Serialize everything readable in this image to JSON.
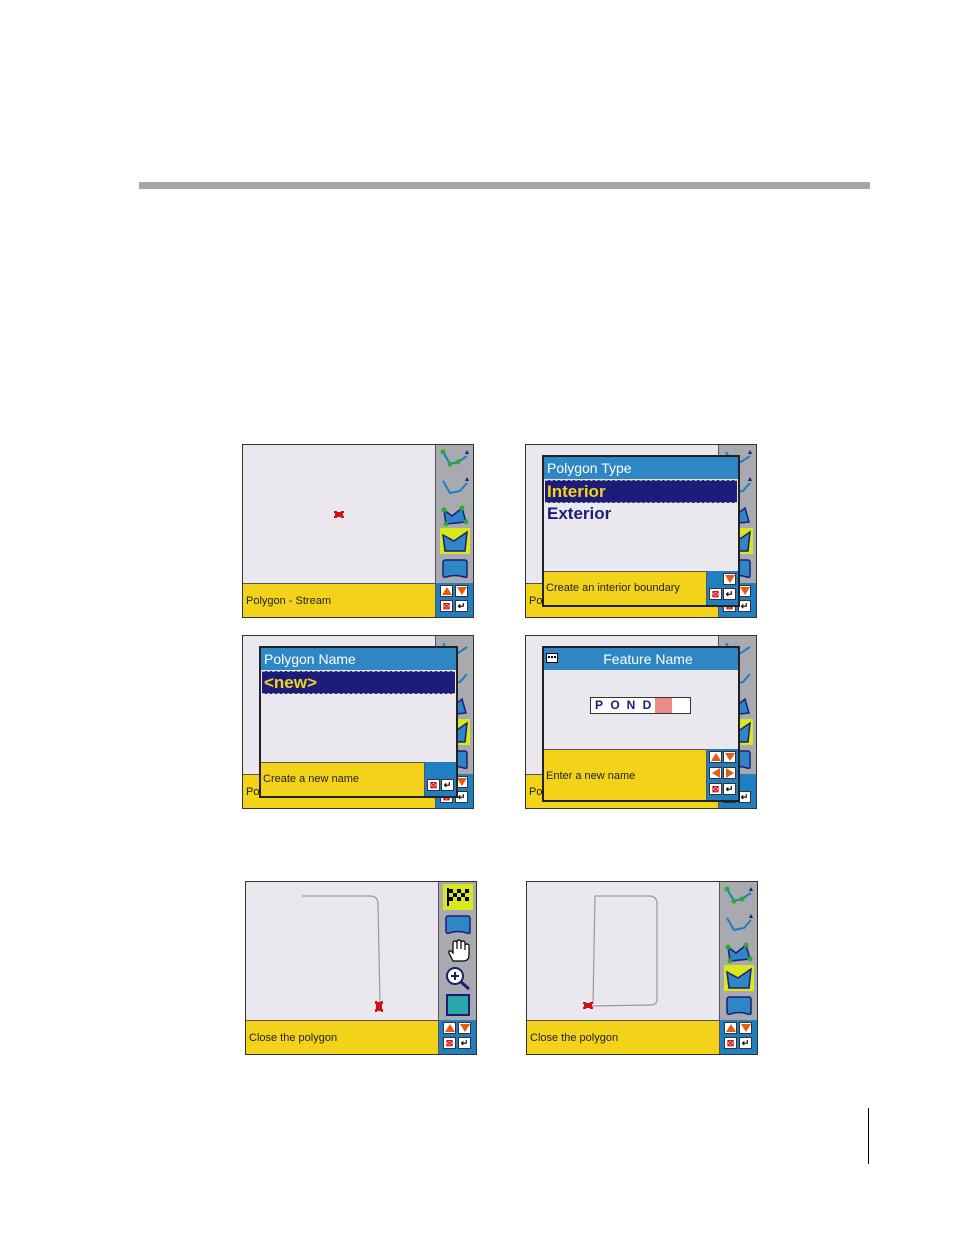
{
  "screens": [
    {
      "id": "s1",
      "status": "Polygon - Stream",
      "toolbar": [
        "line-vertices-icon",
        "stream-line-icon",
        "polygon-vertices-icon",
        "stream-polygon-icon",
        "area-shape-icon"
      ],
      "active_tool": "stream-polygon-icon"
    },
    {
      "id": "s2",
      "status": "Pol",
      "dialog": {
        "title": "Polygon Type",
        "items": [
          "Interior",
          "Exterior"
        ],
        "selected": "Interior",
        "status": "Create an interior boundary"
      }
    },
    {
      "id": "s3",
      "status": "Pol",
      "dialog": {
        "title": "Polygon Name",
        "items": [
          "<new>"
        ],
        "selected": "<new>",
        "status": "Create a new name"
      }
    },
    {
      "id": "s4",
      "status": "Pol",
      "dialog": {
        "title": "Feature Name",
        "input_letters": [
          "P",
          "O",
          "N",
          "D"
        ],
        "status": "Enter a new name"
      }
    },
    {
      "id": "s5",
      "status": "Close the polygon",
      "toolbar": [
        "checkered-flag-icon",
        "area-shape-icon",
        "pan-hand-icon",
        "zoom-in-icon",
        "teal-square-icon"
      ],
      "active_tool": "checkered-flag-icon"
    },
    {
      "id": "s6",
      "status": "Close the polygon",
      "toolbar": [
        "line-vertices-icon",
        "stream-line-icon",
        "polygon-vertices-icon",
        "stream-polygon-icon",
        "area-shape-icon"
      ],
      "active_tool": "stream-polygon-icon"
    }
  ],
  "controls": {
    "cancel_glyph": "⊠",
    "enter_glyph": "↵"
  },
  "colors": {
    "status_yellow": "#f2d31a",
    "title_blue": "#2f86c4",
    "selection_navy": "#1d1c7a",
    "active_tool": "#d8e81a",
    "arrow_orange": "#e85a10"
  }
}
